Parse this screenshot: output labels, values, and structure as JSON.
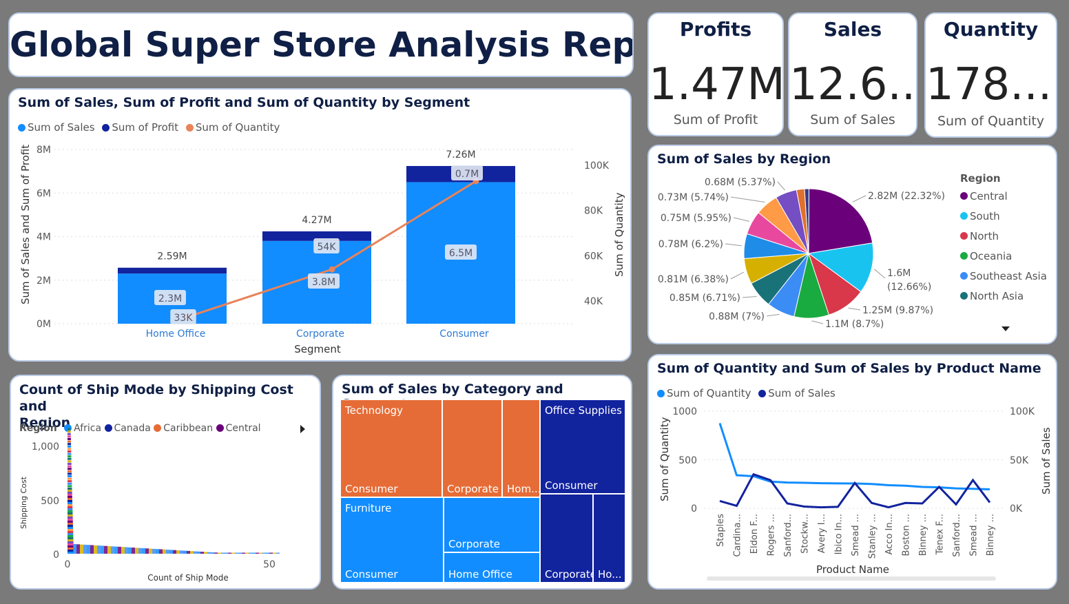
{
  "title": "Global Super Store Analysis Report",
  "kpis": [
    {
      "title": "Profits",
      "value": "1.47M",
      "sub": "Sum of Profit"
    },
    {
      "title": "Sales",
      "value": "12.6...",
      "sub": "Sum of Sales"
    },
    {
      "title": "Quantity",
      "value": "178....",
      "sub": "Sum of Quantity"
    }
  ],
  "segment_chart": {
    "title": "Sum of Sales, Sum of Profit and Sum of Quantity by Segment",
    "legend": [
      {
        "label": "Sum of Sales",
        "color": "#118dff"
      },
      {
        "label": "Sum of Profit",
        "color": "#12239e"
      },
      {
        "label": "Sum of Quantity",
        "color": "#e8835a"
      }
    ],
    "xlabel": "Segment",
    "ylabel": "Sum of Sales and Sum of Profit",
    "y2label": "Sum of Quantity",
    "yticks": [
      "0M",
      "2M",
      "4M",
      "6M",
      "8M"
    ],
    "y2ticks": [
      "40K",
      "60K",
      "80K",
      "100K"
    ]
  },
  "region_pie": {
    "title": "Sum of Sales by Region",
    "legend_title": "Region",
    "legend": [
      {
        "label": "Central",
        "color": "#6b007b"
      },
      {
        "label": "South",
        "color": "#19c3f0"
      },
      {
        "label": "North",
        "color": "#d9374a"
      },
      {
        "label": "Oceania",
        "color": "#1aab40"
      },
      {
        "label": "Southeast Asia",
        "color": "#3c8cf5"
      },
      {
        "label": "North Asia",
        "color": "#197278"
      }
    ]
  },
  "ship_chart": {
    "title_line1": "Count of Ship Mode by Shipping Cost and",
    "title_line2": "Region",
    "legend_title": "Region",
    "legend": [
      {
        "label": "Africa",
        "color": "#118dff"
      },
      {
        "label": "Canada",
        "color": "#12239e"
      },
      {
        "label": "Caribbean",
        "color": "#e66c37"
      },
      {
        "label": "Central",
        "color": "#6b007b"
      }
    ],
    "xlabel": "Count of Ship Mode",
    "ylabel": "Shipping Cost",
    "yticks": [
      "0",
      "500",
      "1,000"
    ],
    "xticks": [
      "0",
      "50"
    ]
  },
  "treemap": {
    "title": "Sum of Sales by Category and Segment",
    "groups": {
      "technology": "Technology",
      "office": "Office Supplies",
      "furniture": "Furniture"
    },
    "cells": {
      "tech_consumer": "Consumer",
      "tech_corporate": "Corporate",
      "tech_home": "Hom...",
      "office_consumer": "Consumer",
      "office_corporate": "Corporate",
      "office_home": "Ho...",
      "furn_consumer": "Consumer",
      "furn_corporate": "Corporate",
      "furn_home": "Home Office"
    }
  },
  "product_chart": {
    "title": "Sum of Quantity and Sum of Sales by Product Name",
    "legend": [
      {
        "label": "Sum of Quantity",
        "color": "#118dff"
      },
      {
        "label": "Sum of Sales",
        "color": "#12239e"
      }
    ],
    "xlabel": "Product Name",
    "ylabel": "Sum of Quantity",
    "y2label": "Sum of Sales",
    "yticks": [
      "0",
      "500",
      "1000"
    ],
    "y2ticks": [
      "0K",
      "50K",
      "100K"
    ]
  },
  "chart_data": [
    {
      "type": "bar",
      "title": "Sum of Sales, Sum of Profit and Sum of Quantity by Segment",
      "categories": [
        "Home Office",
        "Corporate",
        "Consumer"
      ],
      "series": [
        {
          "name": "Sum of Sales",
          "values": [
            2.3,
            3.8,
            6.5
          ],
          "labels": [
            "2.3M",
            "3.8M",
            "6.5M"
          ]
        },
        {
          "name": "Sum of Profit",
          "values": [
            0.27,
            0.44,
            0.74
          ],
          "labels": [
            "",
            "",
            "0.7M"
          ]
        },
        {
          "name": "Sum of Quantity",
          "values": [
            33000,
            54000,
            93000
          ],
          "labels": [
            "33K",
            "54K",
            ""
          ]
        }
      ],
      "totals": [
        "2.59M",
        "4.27M",
        "7.26M"
      ],
      "ylim": [
        0,
        8
      ],
      "y2lim": [
        30000,
        107000
      ]
    },
    {
      "type": "pie",
      "title": "Sum of Sales by Region",
      "slices": [
        {
          "label": "2.82M (22.32%)",
          "value": 22.32,
          "color": "#6b007b"
        },
        {
          "label": "1.6M (12.66%)",
          "value": 12.66,
          "color": "#19c3f0"
        },
        {
          "label": "1.25M (9.87%)",
          "value": 9.87,
          "color": "#d9374a"
        },
        {
          "label": "1.1M (8.7%)",
          "value": 8.7,
          "color": "#1aab40"
        },
        {
          "label": "0.88M (7%)",
          "value": 7.0,
          "color": "#3c8cf5"
        },
        {
          "label": "0.85M (6.71%)",
          "value": 6.71,
          "color": "#197278"
        },
        {
          "label": "0.81M (6.38%)",
          "value": 6.38,
          "color": "#d6b000"
        },
        {
          "label": "0.78M (6.2%)",
          "value": 6.2,
          "color": "#1f8ce8"
        },
        {
          "label": "0.75M (5.95%)",
          "value": 5.95,
          "color": "#e8489e"
        },
        {
          "label": "0.73M (5.74%)",
          "value": 5.74,
          "color": "#ff9a46"
        },
        {
          "label": "0.68M (5.37%)",
          "value": 5.37,
          "color": "#744ec2"
        },
        {
          "label": "",
          "value": 2.0,
          "color": "#e0702e"
        },
        {
          "label": "",
          "value": 1.1,
          "color": "#3a3a8a"
        }
      ]
    },
    {
      "type": "line",
      "title": "Sum of Quantity and Sum of Sales by Product Name",
      "categories": [
        "Staples",
        "Cardina...",
        "Eldon F...",
        "Rogers ...",
        "Sanford...",
        "Stockw...",
        "Avery I...",
        "Ibico In...",
        "Smead ...",
        "Stanley ...",
        "Acco In...",
        "Boston ...",
        "Binney ...",
        "Tenex F...",
        "Sanford...",
        "Smead ...",
        "Binney ..."
      ],
      "series": [
        {
          "name": "Sum of Quantity",
          "values": [
            876,
            340,
            330,
            275,
            265,
            262,
            258,
            256,
            255,
            250,
            238,
            232,
            220,
            215,
            205,
            200,
            195
          ]
        },
        {
          "name": "Sum of Sales",
          "values": [
            7500,
            2500,
            35000,
            29000,
            5000,
            1800,
            1000,
            1500,
            26000,
            5500,
            1000,
            5500,
            5000,
            22000,
            4000,
            29000,
            6000
          ]
        }
      ],
      "ylim": [
        0,
        1000
      ],
      "y2lim": [
        0,
        100000
      ]
    }
  ]
}
